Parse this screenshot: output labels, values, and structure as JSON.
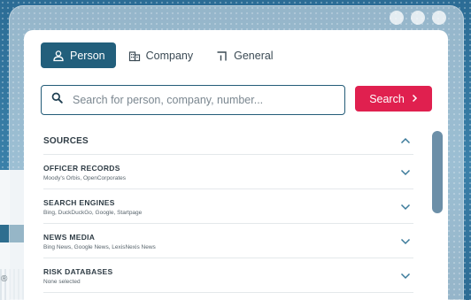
{
  "tabs": [
    {
      "label": "Person",
      "icon": "person-icon",
      "active": true
    },
    {
      "label": "Company",
      "icon": "building-icon",
      "active": false
    },
    {
      "label": "General",
      "icon": "corner-icon",
      "active": false
    }
  ],
  "search": {
    "placeholder": "Search for person, company, number...",
    "value": "",
    "button_label": "Search"
  },
  "sources": {
    "title": "SOURCES",
    "items": [
      {
        "name": "OFFICER RECORDS",
        "desc": "Moody's Orbis, OpenCorporates"
      },
      {
        "name": "SEARCH ENGINES",
        "desc": "Bing, DuckDuckGo, Google, Startpage"
      },
      {
        "name": "NEWS MEDIA",
        "desc": "Bing News, Google News, LexisNexis News"
      },
      {
        "name": "RISK DATABASES",
        "desc": "None selected"
      }
    ]
  },
  "colors": {
    "primary": "#225f7c",
    "accent": "#e0204f",
    "scrollbar": "#6c8fa8"
  }
}
